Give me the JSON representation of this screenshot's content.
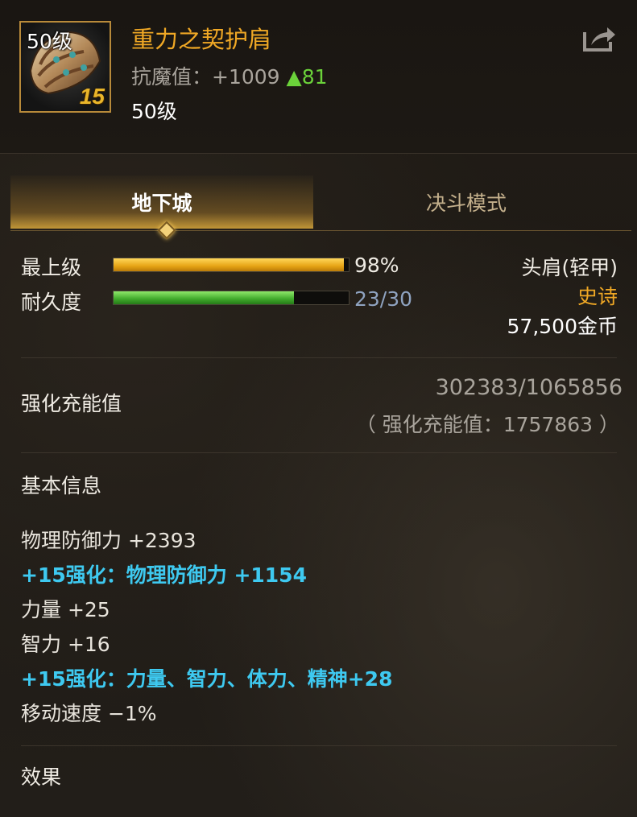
{
  "item": {
    "icon_level": "50级",
    "enhancement": "15",
    "name": "重力之契护肩",
    "resist_label": "抗魔值：",
    "resist_value": "+1009",
    "resist_delta": "▲81",
    "level": "50级",
    "share_icon": "share-icon"
  },
  "tabs": [
    {
      "label": "地下城",
      "active": true
    },
    {
      "label": "决斗模式",
      "active": false
    }
  ],
  "bars": {
    "quality": {
      "label": "最上级",
      "value_text": "98%",
      "fraction": 0.98
    },
    "durability": {
      "label": "耐久度",
      "value_text": "23/30",
      "fraction": 0.7667
    }
  },
  "item_info": {
    "slot": "头肩(轻甲)",
    "rarity": "史诗",
    "price": "57,500金币"
  },
  "charge": {
    "label": "强化充能值",
    "value": "302383/1065856",
    "total": "（ 强化充能值：1757863 ）"
  },
  "basic_info": {
    "title": "基本信息",
    "stats": [
      {
        "text": "物理防御力 +2393",
        "highlight": false
      },
      {
        "text": "+15强化：物理防御力 +1154",
        "highlight": true
      },
      {
        "text": "力量 +25",
        "highlight": false
      },
      {
        "text": "智力 +16",
        "highlight": false
      },
      {
        "text": "+15强化：力量、智力、体力、精神+28",
        "highlight": true
      },
      {
        "text": "移动速度 −1%",
        "highlight": false
      }
    ]
  },
  "effects": {
    "title": "效果"
  },
  "colors": {
    "name": "#f0a825",
    "rarity": "#f0a825",
    "positive_delta": "#6bd23a",
    "enhance_text": "#3ec9f0",
    "durability_text": "#8fa3c0"
  }
}
